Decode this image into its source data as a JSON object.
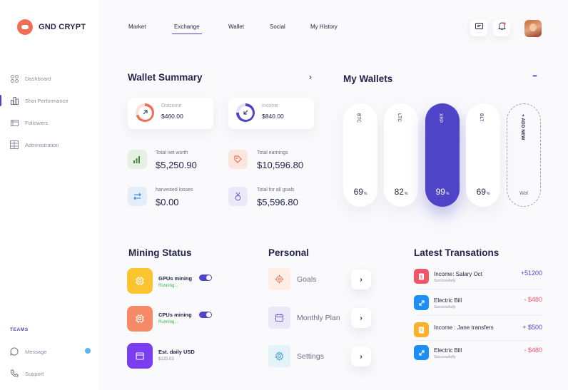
{
  "app": {
    "name": "GND CRYPT"
  },
  "sidebar": {
    "items": [
      {
        "label": "Dashboard",
        "icon": "grid-icon"
      },
      {
        "label": "Shot Performance",
        "icon": "bar-chart-icon"
      },
      {
        "label": "Followers",
        "icon": "list-icon"
      },
      {
        "label": "Administration",
        "icon": "table-icon"
      }
    ],
    "teams_heading": "TEAMS",
    "bottom_items": [
      {
        "label": "Message",
        "icon": "chat-bubble-icon"
      },
      {
        "label": "Support",
        "icon": "phone-icon"
      }
    ]
  },
  "topnav": {
    "tabs": [
      "Market",
      "Exchange",
      "Wallet",
      "Social",
      "My History"
    ],
    "active_tab": "Exchange"
  },
  "wallet_summary": {
    "title": "Wallet Summary",
    "outcome": {
      "label": "Outcome",
      "value": "$460.00"
    },
    "income": {
      "label": "Income",
      "value": "$840.00"
    },
    "stats": [
      {
        "label": "Total net worth",
        "value": "$5,250.90"
      },
      {
        "label": "Total earnings",
        "value": "$10,596.80"
      },
      {
        "label": "harvested losses",
        "value": "$0.00"
      },
      {
        "label": "Total for all goals",
        "value": "$5,596.80"
      }
    ]
  },
  "my_wallets": {
    "title": "My Wallets",
    "more": "•••",
    "wallets": [
      {
        "name": "BTC",
        "percent": "69",
        "unit": "%"
      },
      {
        "name": "LTC",
        "percent": "82",
        "unit": "%"
      },
      {
        "name": "XRP",
        "percent": "99",
        "unit": "%"
      },
      {
        "name": "BLT",
        "percent": "69",
        "unit": "%"
      }
    ],
    "add_label": "+ ADD NEW",
    "add_sub": "Wal"
  },
  "mining": {
    "title": "Mining Status",
    "items": [
      {
        "title": "GPUs mining",
        "sub": "Running..."
      },
      {
        "title": "CPUs mining",
        "sub": "Running..."
      },
      {
        "title": "Est. daily USD",
        "sub": "$125.03"
      }
    ]
  },
  "personal": {
    "title": "Personal",
    "items": [
      {
        "label": "Goals"
      },
      {
        "label": "Monthly Plan"
      },
      {
        "label": "Settings"
      }
    ]
  },
  "transactions": {
    "title": "Latest Transations",
    "items": [
      {
        "title": "Income: Salary Oct",
        "sub": "",
        "amount": "+51200"
      },
      {
        "title": "Electric Bill",
        "sub": "Successfully",
        "amount": "- $480"
      },
      {
        "title": "Income : Jane transfers",
        "sub": "",
        "amount": "+ $500"
      },
      {
        "title": "Electric Bill",
        "sub": "Successfully",
        "amount": "- $480"
      }
    ],
    "salary_sub": "Successfully"
  },
  "colors": {
    "accent": "#4f44c8",
    "orange": "#f06f54",
    "positive": "#4f44c8",
    "negative": "#f0566a"
  }
}
